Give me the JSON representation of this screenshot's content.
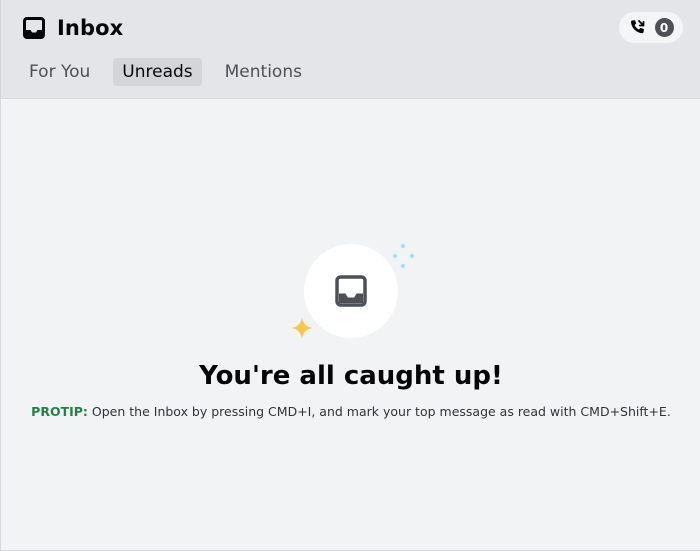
{
  "header": {
    "title": "Inbox",
    "call_badge_count": "0",
    "tabs": [
      {
        "label": "For You",
        "active": false
      },
      {
        "label": "Unreads",
        "active": true
      },
      {
        "label": "Mentions",
        "active": false
      }
    ]
  },
  "empty_state": {
    "heading": "You're all caught up!",
    "protip_label": "PROTIP:",
    "protip_text": " Open the Inbox by pressing CMD+I, and mark your top message as read with CMD+Shift+E."
  },
  "colors": {
    "header_bg": "#e3e5e8",
    "body_bg": "#f2f3f5",
    "protip_green": "#248046",
    "sparkle_yellow": "#f7c948",
    "sparkle_blue": "#a6e0f5",
    "icon_gray": "#4e5058"
  },
  "icons": [
    "inbox-icon",
    "phone-missed-icon",
    "inbox-tray-icon",
    "sparkle-icon"
  ]
}
